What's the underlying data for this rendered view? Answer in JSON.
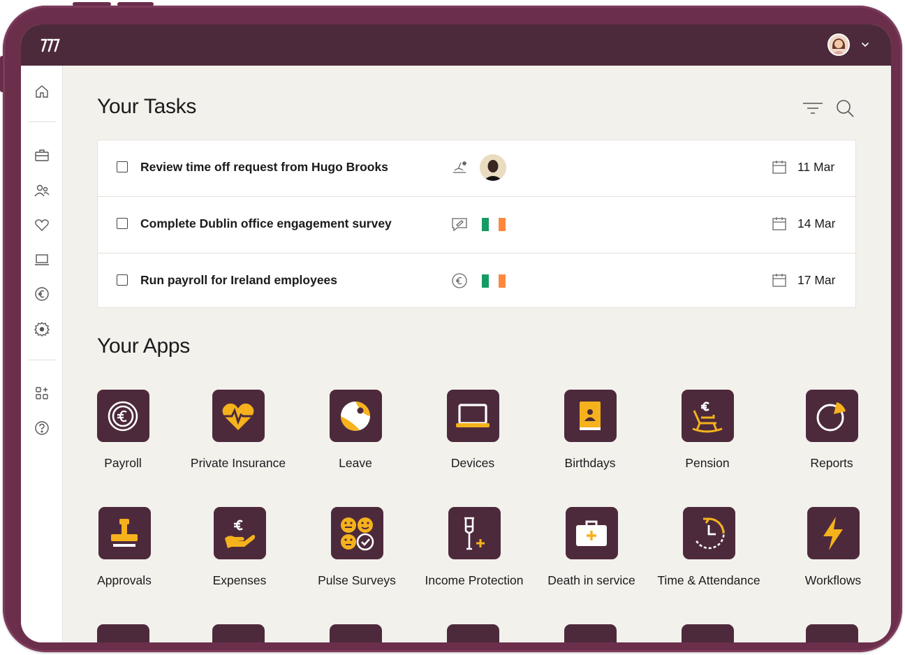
{
  "topbar": {
    "logo": "ꭆꭆ",
    "user_menu": "user-menu"
  },
  "sidebar": {
    "items": [
      {
        "name": "home"
      },
      {
        "name": "company"
      },
      {
        "name": "people"
      },
      {
        "name": "benefits"
      },
      {
        "name": "devices"
      },
      {
        "name": "payroll"
      },
      {
        "name": "settings"
      },
      {
        "name": "add-apps"
      },
      {
        "name": "help"
      }
    ]
  },
  "tasks_section": {
    "title": "Your Tasks",
    "tasks": [
      {
        "label": "Review time off request from Hugo Brooks",
        "type_icon": "beach-icon",
        "assignee": "person-avatar",
        "date": "11 Mar"
      },
      {
        "label": "Complete Dublin office engagement survey",
        "type_icon": "survey-icon",
        "assignee": "ireland-flag",
        "date": "14 Mar"
      },
      {
        "label": "Run payroll for Ireland employees",
        "type_icon": "euro-icon",
        "assignee": "ireland-flag",
        "date": "17 Mar"
      }
    ]
  },
  "apps_section": {
    "title": "Your Apps",
    "apps": [
      {
        "label": "Payroll",
        "icon": "euro-coin-icon"
      },
      {
        "label": "Private Insurance",
        "icon": "heart-pulse-icon"
      },
      {
        "label": "Leave",
        "icon": "beach-ball-icon"
      },
      {
        "label": "Devices",
        "icon": "laptop-icon"
      },
      {
        "label": "Birthdays",
        "icon": "contact-book-icon"
      },
      {
        "label": "Pension",
        "icon": "rocking-chair-icon"
      },
      {
        "label": "Reports",
        "icon": "pie-chart-icon"
      },
      {
        "label": "Approvals",
        "icon": "stamp-icon"
      },
      {
        "label": "Expenses",
        "icon": "hand-euro-icon"
      },
      {
        "label": "Pulse Surveys",
        "icon": "smileys-icon"
      },
      {
        "label": "Income Protection",
        "icon": "crutch-icon"
      },
      {
        "label": "Death in service",
        "icon": "first-aid-kit-icon"
      },
      {
        "label": "Time & Attendance",
        "icon": "clock-icon"
      },
      {
        "label": "Workflows",
        "icon": "lightning-icon"
      }
    ]
  },
  "colors": {
    "brand": "#4d2a3b",
    "accent": "#f5b21c",
    "bg": "#f3f1ec",
    "device": "#6b2f4c",
    "flag_green": "#169b62",
    "flag_orange": "#ff883e"
  }
}
